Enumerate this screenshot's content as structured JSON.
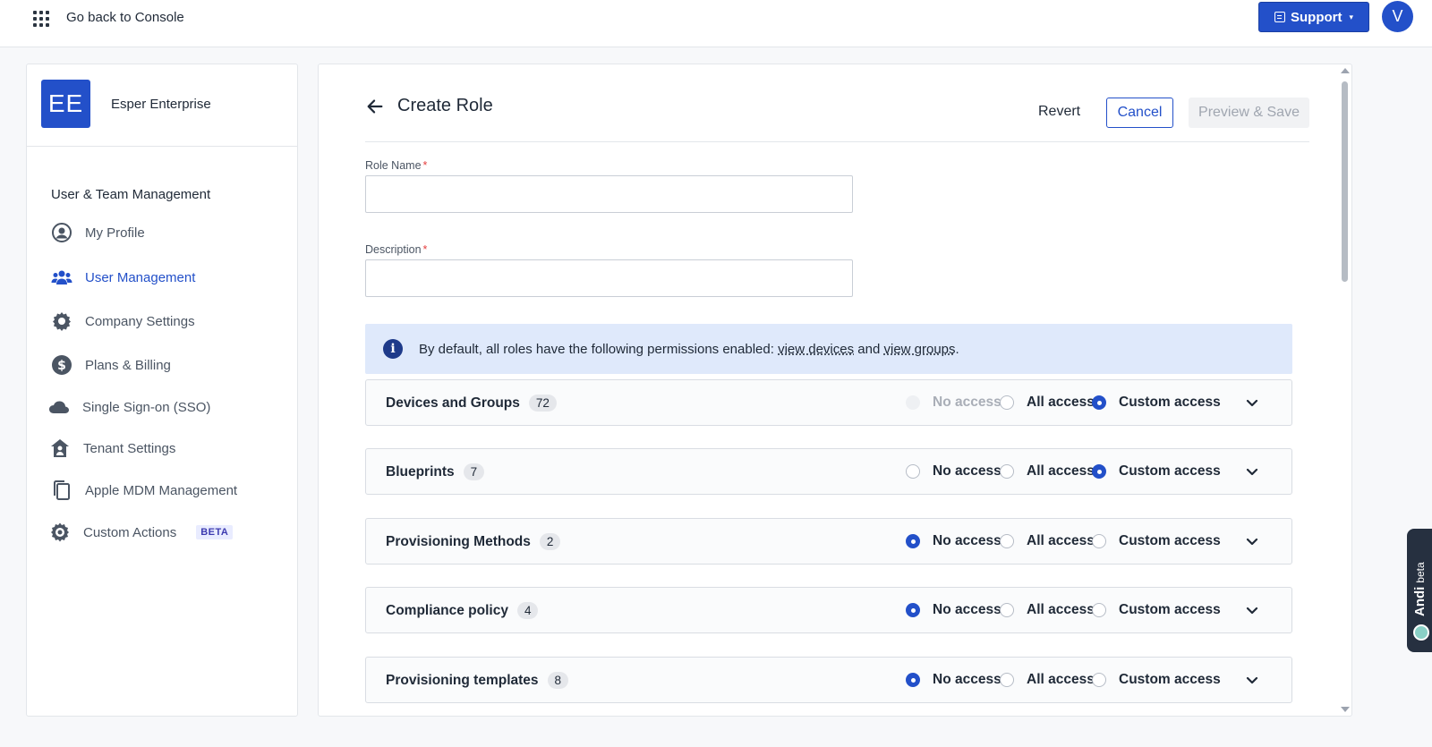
{
  "topbar": {
    "back_label": "Go back to Console",
    "support_label": "Support",
    "avatar_initial": "V"
  },
  "sidebar": {
    "org_initials": "EE",
    "org_name": "Esper Enterprise",
    "section_title": "User & Team Management",
    "items": [
      {
        "label": "My Profile",
        "icon": "user-circle-icon",
        "active": false
      },
      {
        "label": "User Management",
        "icon": "users-icon",
        "active": true
      },
      {
        "label": "Company Settings",
        "icon": "gear-icon",
        "active": false
      },
      {
        "label": "Plans & Billing",
        "icon": "dollar-icon",
        "active": false
      },
      {
        "label": "Single Sign-on (SSO)",
        "icon": "cloud-icon",
        "active": false
      },
      {
        "label": "Tenant Settings",
        "icon": "house-icon",
        "active": false
      },
      {
        "label": "Apple MDM Management",
        "icon": "copy-icon",
        "active": false
      },
      {
        "label": "Custom Actions",
        "icon": "gear-badge-icon",
        "active": false,
        "badge": "BETA"
      }
    ]
  },
  "main": {
    "title": "Create Role",
    "revert_label": "Revert",
    "cancel_label": "Cancel",
    "save_label": "Preview & Save",
    "role_name": {
      "label": "Role Name",
      "required": "*",
      "value": ""
    },
    "description": {
      "label": "Description",
      "required": "*",
      "value": ""
    },
    "info": {
      "text_prefix": "By default, all roles have the following permissions enabled: ",
      "link1": "view devices",
      "mid": " and ",
      "link2": "view groups",
      "suffix": "."
    },
    "options": {
      "none": "No access",
      "all": "All access",
      "custom": "Custom access"
    },
    "permissions": [
      {
        "name": "Devices and Groups",
        "count": "72",
        "selected": "custom",
        "no_access_disabled": true
      },
      {
        "name": "Blueprints",
        "count": "7",
        "selected": "custom",
        "no_access_disabled": false
      },
      {
        "name": "Provisioning Methods",
        "count": "2",
        "selected": "none",
        "no_access_disabled": false
      },
      {
        "name": "Compliance policy",
        "count": "4",
        "selected": "none",
        "no_access_disabled": false
      },
      {
        "name": "Provisioning templates",
        "count": "8",
        "selected": "none",
        "no_access_disabled": false
      }
    ]
  },
  "andi": {
    "label": "Andi",
    "badge": "beta"
  },
  "colors": {
    "primary": "#2350c9",
    "info_bg": "#dfe9fb",
    "required": "#e53e3e"
  }
}
